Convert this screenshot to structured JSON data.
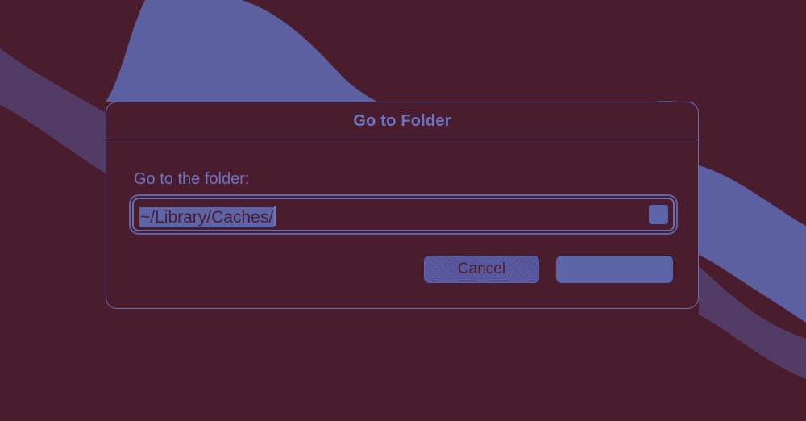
{
  "dialog": {
    "title": "Go to Folder",
    "prompt": "Go to the folder:",
    "path_value": "~/Library/Caches/",
    "buttons": {
      "cancel_label": "Cancel",
      "go_label": ""
    }
  },
  "colors": {
    "background": "#4a1d2e",
    "wallpaper_wave": "#5d64a8",
    "accent_text": "#6c74c4",
    "border": "#6a6fb0"
  }
}
